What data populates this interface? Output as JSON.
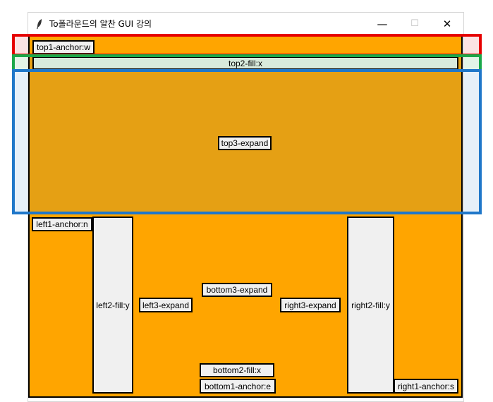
{
  "window": {
    "title": "To폴라운드의 알찬 GUI 강의",
    "app_icon": "feather-icon",
    "buttons": {
      "minimize": "—",
      "maximize": "☐",
      "close": "✕"
    }
  },
  "colors": {
    "client_bg": "#ffa500",
    "label_bg": "#f0f0f0",
    "highlight_red": "#e60000",
    "highlight_green": "#1aa84a",
    "highlight_blue": "#1f77c9"
  },
  "labels": {
    "top1": "top1-anchor:w",
    "top2": "top2-fill:x",
    "top3": "top3-expand",
    "left1": "left1-anchor:n",
    "left2": "left2-fill:y",
    "left3": "left3-expand",
    "bottom3": "bottom3-expand",
    "right3": "right3-expand",
    "right2": "right2-fill:y",
    "bottom2": "bottom2-fill:x",
    "bottom1": "bottom1-anchor:e",
    "right1": "right1-anchor:s"
  }
}
